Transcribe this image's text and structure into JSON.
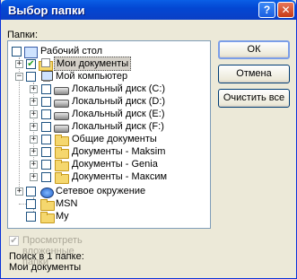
{
  "window": {
    "title": "Выбор папки",
    "help_glyph": "?",
    "close_glyph": "✕"
  },
  "folders_label": "Папки:",
  "tree": {
    "items": [
      {
        "label": "Рабочий стол",
        "icon": "desktop-icon",
        "checked": false,
        "expander": ""
      },
      {
        "label": "Мои документы",
        "icon": "my-documents-icon",
        "checked": true,
        "expander": "+"
      },
      {
        "label": "Мой компьютер",
        "icon": "my-computer-icon",
        "checked": false,
        "expander": "−"
      },
      {
        "label": "Локальный диск (C:)",
        "icon": "drive-icon",
        "checked": false,
        "expander": "+"
      },
      {
        "label": "Локальный диск (D:)",
        "icon": "drive-icon",
        "checked": false,
        "expander": "+"
      },
      {
        "label": "Локальный диск (E:)",
        "icon": "drive-icon",
        "checked": false,
        "expander": "+"
      },
      {
        "label": "Локальный диск (F:)",
        "icon": "drive-icon",
        "checked": false,
        "expander": "+"
      },
      {
        "label": "Общие документы",
        "icon": "folder-icon",
        "checked": false,
        "expander": "+"
      },
      {
        "label": "Документы - Maksim",
        "icon": "folder-icon",
        "checked": false,
        "expander": "+"
      },
      {
        "label": "Документы - Genia",
        "icon": "folder-icon",
        "checked": false,
        "expander": "+"
      },
      {
        "label": "Документы - Максим",
        "icon": "folder-icon",
        "checked": false,
        "expander": "+"
      },
      {
        "label": "Сетевое окружение",
        "icon": "network-icon",
        "checked": false,
        "expander": "+"
      },
      {
        "label": "MSN",
        "icon": "folder-icon",
        "checked": false,
        "expander": ""
      },
      {
        "label": "My",
        "icon": "folder-icon",
        "checked": false,
        "expander": ""
      }
    ]
  },
  "buttons": {
    "ok": "ОК",
    "cancel": "Отмена",
    "clear_all": "Очистить все"
  },
  "recursive_label": "Просмотреть вложенные папки",
  "search_in": {
    "label": "Поиск в 1 папке:",
    "value": "Мои документы"
  },
  "colors": {
    "title_bar": "#0a5fe6",
    "window_bg": "#ece9d8",
    "check_mark": "#21a121"
  }
}
